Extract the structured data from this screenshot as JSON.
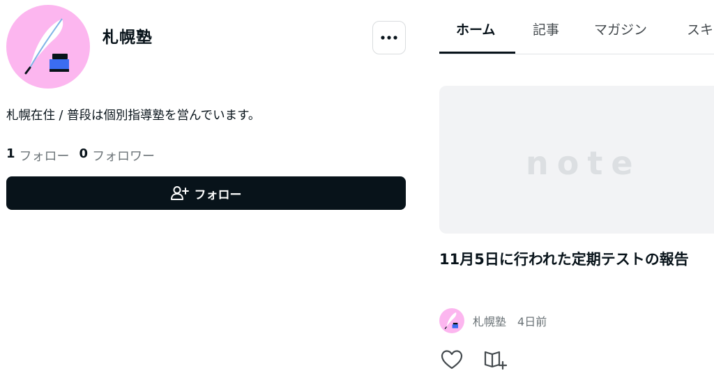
{
  "profile": {
    "name": "札幌塾",
    "bio": "札幌在住 / 普段は個別指導塾を営んでいます。",
    "following_count": "1",
    "following_label": "フォロー",
    "followers_count": "0",
    "followers_label": "フォロワー",
    "follow_button_label": "フォロー",
    "avatar_color": "#fcb6ef"
  },
  "tabs": [
    {
      "label": "ホーム",
      "active": true
    },
    {
      "label": "記事",
      "active": false
    },
    {
      "label": "マガジン",
      "active": false
    },
    {
      "label": "スキ",
      "active": false
    }
  ],
  "article": {
    "thumbnail_text": "note",
    "title": "11月5日に行われた定期テストの報告",
    "author": "札幌塾",
    "time": "4日前"
  },
  "icons": {
    "more": "more-dots-icon",
    "follow": "person-add-icon",
    "like": "heart-icon",
    "add_to_magazine": "magazine-add-icon"
  },
  "colors": {
    "primary": "#08131a",
    "muted": "#6b7377",
    "thumbnail_bg": "#f2f3f5"
  }
}
